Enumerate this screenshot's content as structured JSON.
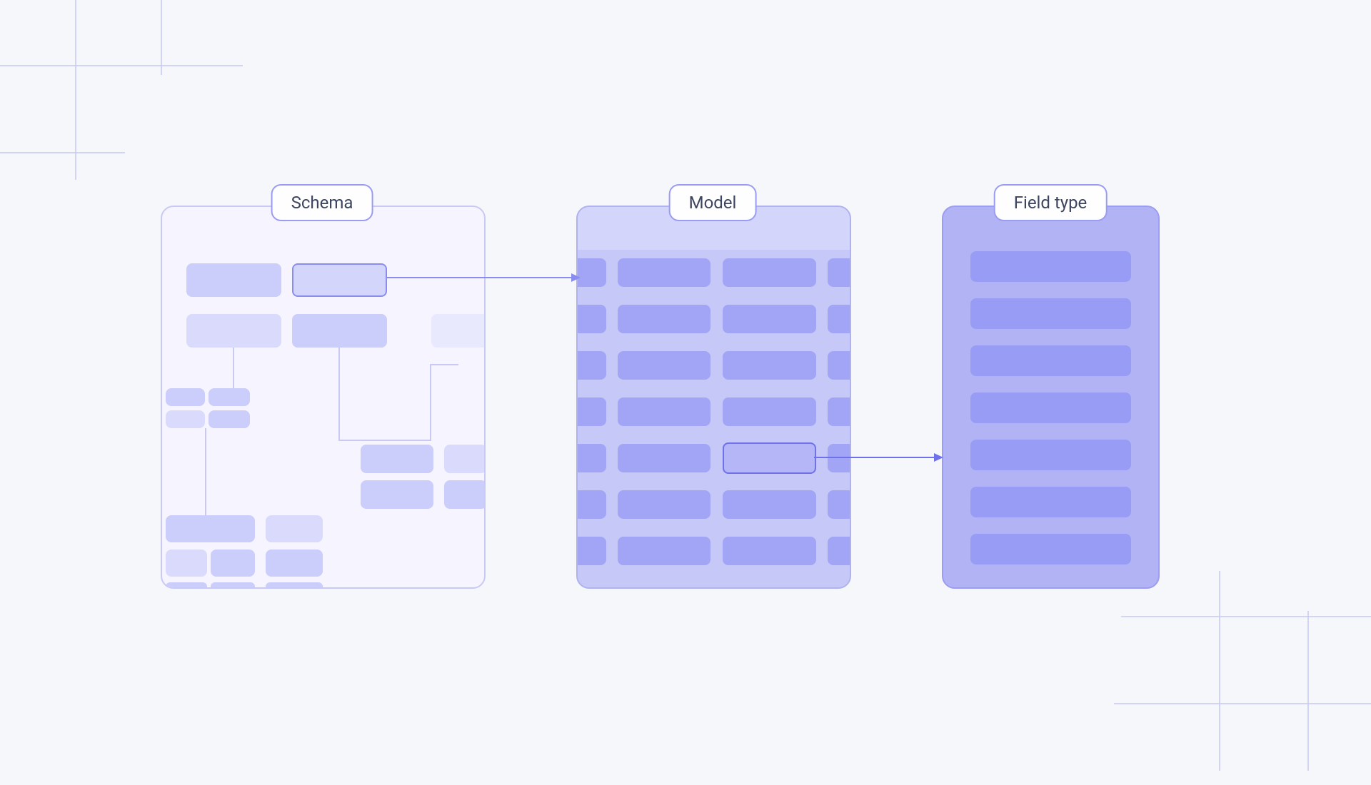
{
  "labels": {
    "schema": "Schema",
    "model": "Model",
    "field": "Field type"
  },
  "colors": {
    "background": "#f6f7fb",
    "schema_bg": "#f6f4ff",
    "model_bg": "#c6c8f7",
    "field_bg": "#b1b3f5",
    "accent": "#8a8df0",
    "pill_bg": "#fefeff",
    "pill_text": "#3c445f"
  },
  "diagram": {
    "panels": [
      "Schema",
      "Model",
      "Field type"
    ],
    "connections": [
      {
        "from": "Schema",
        "to": "Model"
      },
      {
        "from": "Model",
        "to": "Field type"
      }
    ]
  }
}
